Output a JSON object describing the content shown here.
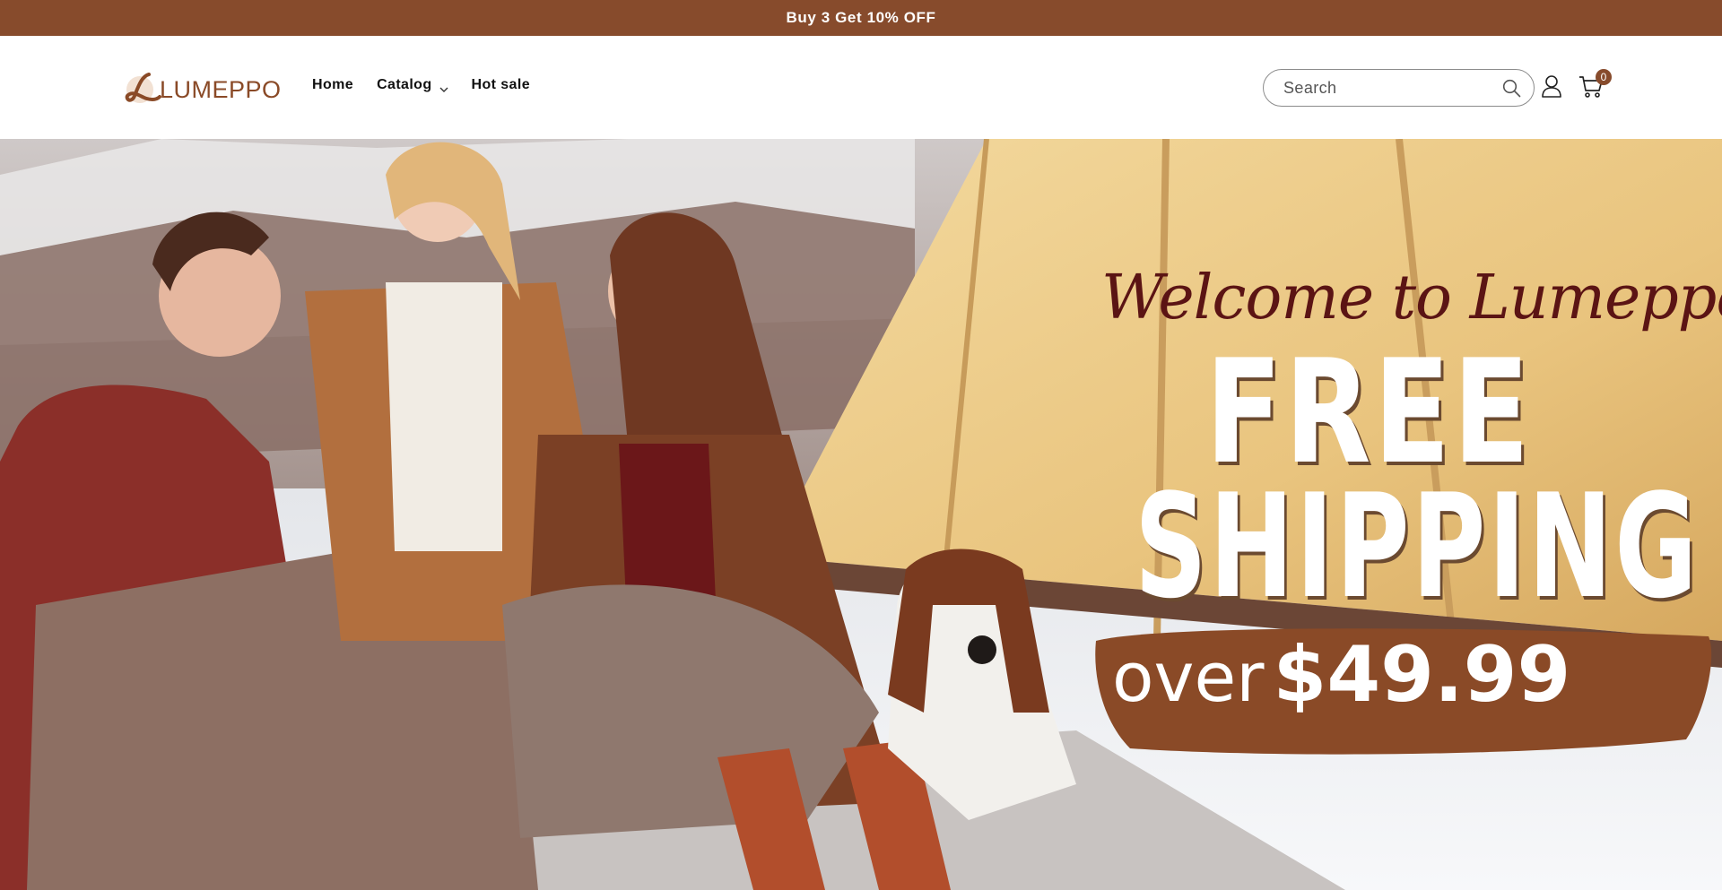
{
  "announcement": {
    "text": "Buy 3 Get 10% OFF"
  },
  "header": {
    "logo_text": "LUMEPPO",
    "nav": [
      {
        "label": "Home"
      },
      {
        "label": "Catalog",
        "has_dropdown": true
      },
      {
        "label": "Hot sale"
      }
    ],
    "search": {
      "placeholder": "Search",
      "value": ""
    },
    "cart_count": "0"
  },
  "hero": {
    "welcome": "Welcome to Lumeppo",
    "headline_1": "FREE",
    "headline_2": "SHIPPING",
    "condition_word": "over",
    "threshold": "$49.99"
  },
  "colors": {
    "brand": "#874b2c",
    "announcement_bg": "#874b2c",
    "welcome_text": "#5b1414"
  },
  "icons": [
    "logo-mark-icon",
    "chevron-down-icon",
    "search-icon",
    "account-icon",
    "cart-icon"
  ]
}
